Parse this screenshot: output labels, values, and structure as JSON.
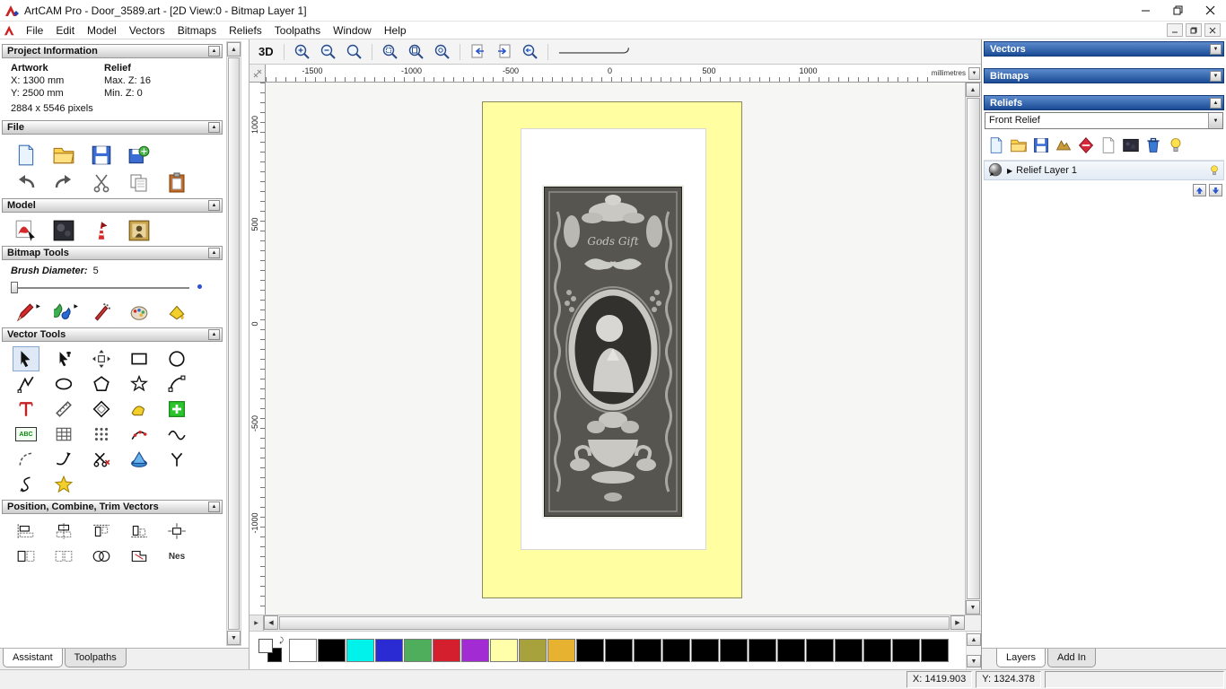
{
  "window": {
    "title": "ArtCAM Pro - Door_3589.art - [2D View:0 - Bitmap Layer 1]"
  },
  "menu": {
    "items": [
      "File",
      "Edit",
      "Model",
      "Vectors",
      "Bitmaps",
      "Reliefs",
      "Toolpaths",
      "Window",
      "Help"
    ]
  },
  "assistant": {
    "project_info": {
      "title": "Project Information",
      "artwork_header": "Artwork",
      "relief_header": "Relief",
      "artwork_x": "X: 1300 mm",
      "artwork_y": "Y: 2500 mm",
      "relief_max": "Max. Z: 16",
      "relief_min": "Min. Z: 0",
      "pixels": "2884 x 5546 pixels"
    },
    "file": {
      "title": "File"
    },
    "model": {
      "title": "Model"
    },
    "bitmap_tools": {
      "title": "Bitmap Tools",
      "brush_label": "Brush Diameter:",
      "brush_value": "5"
    },
    "vector_tools": {
      "title": "Vector Tools",
      "abc_label": "ABC"
    },
    "position": {
      "title": "Position, Combine, Trim Vectors",
      "nes_label": "Nes"
    },
    "tabs": {
      "assistant": "Assistant",
      "toolpaths": "Toolpaths"
    }
  },
  "viewport": {
    "toolbar": {
      "btn_3d": "3D"
    },
    "h_ruler": {
      "ticks": [
        "-1500",
        "-1000",
        "-500",
        "0",
        "500",
        "1000"
      ],
      "units": "millimetres"
    },
    "v_ruler": {
      "ticks": [
        "1000",
        "500",
        "0",
        "-500",
        "-1000"
      ]
    },
    "artwork": {
      "title_text": "Gods Gift"
    }
  },
  "right_panel": {
    "vectors_title": "Vectors",
    "bitmaps_title": "Bitmaps",
    "reliefs_title": "Reliefs",
    "relief_select": "Front Relief",
    "layer_name": "Relief Layer 1",
    "tabs": {
      "layers": "Layers",
      "addin": "Add In"
    }
  },
  "palette": {
    "colors": [
      "#ffffff",
      "#000000",
      "#00f2ea",
      "#2b2bd4",
      "#4fae5c",
      "#d41f2e",
      "#a32bd4",
      "#ffffaa",
      "#a8a23c",
      "#e8b231",
      "#000000",
      "#000000",
      "#000000",
      "#000000",
      "#000000",
      "#000000",
      "#000000",
      "#000000",
      "#000000",
      "#000000",
      "#000000",
      "#000000",
      "#000000"
    ]
  },
  "status": {
    "x": "X: 1419.903",
    "y": "Y: 1324.378"
  }
}
